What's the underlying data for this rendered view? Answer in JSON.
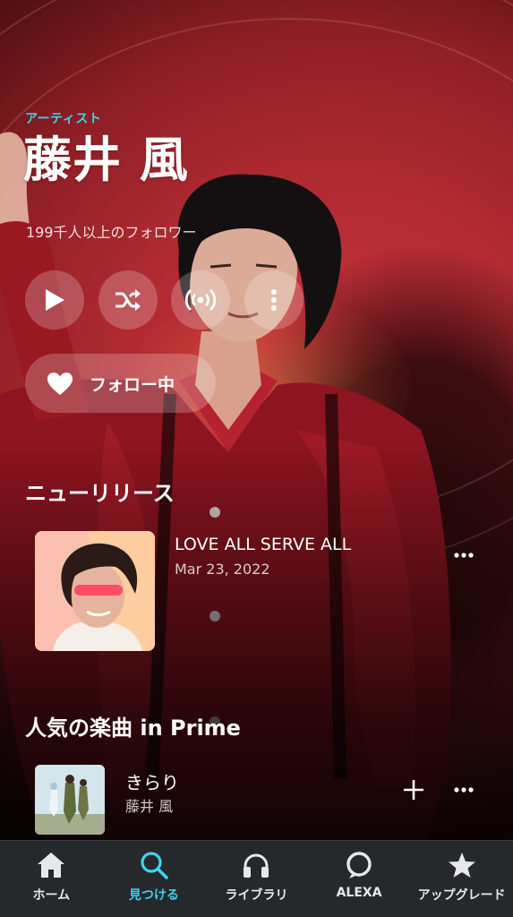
{
  "header": {
    "category": "アーティスト",
    "artist_name": "藤井 風",
    "followers": "199千人以上のフォロワー"
  },
  "actions": {
    "play_icon": "play-icon",
    "shuffle_icon": "shuffle-icon",
    "station_icon": "broadcast-icon",
    "more_icon": "more-vertical-icon",
    "follow_label": "フォロー中"
  },
  "new_releases": {
    "title": "ニューリリース",
    "items": [
      {
        "title": "LOVE ALL SERVE ALL",
        "date": "Mar 23, 2022"
      }
    ]
  },
  "popular": {
    "title": "人気の楽曲 in Prime",
    "items": [
      {
        "title": "きらり",
        "artist": "藤井 風"
      }
    ]
  },
  "nav": {
    "items": [
      {
        "label": "ホーム",
        "icon": "home-icon",
        "active": false
      },
      {
        "label": "見つける",
        "icon": "search-icon",
        "active": true
      },
      {
        "label": "ライブラリ",
        "icon": "headphones-icon",
        "active": false
      },
      {
        "label": "ALEXA",
        "icon": "alexa-ring-icon",
        "active": false
      },
      {
        "label": "アップグレード",
        "icon": "star-icon",
        "active": false
      }
    ]
  },
  "colors": {
    "accent": "#3fd2f2",
    "hero_red": "#b02a31",
    "nav_bg": "#25292c"
  }
}
